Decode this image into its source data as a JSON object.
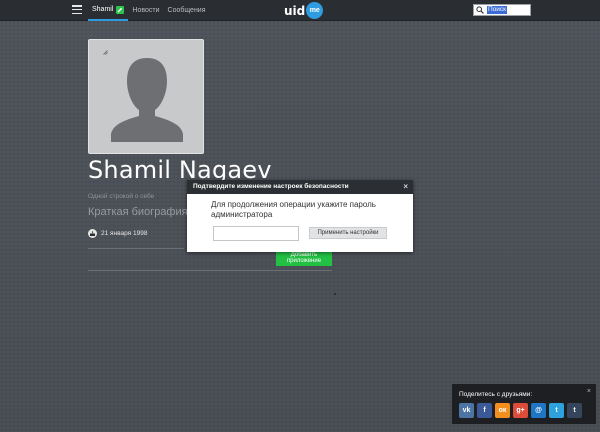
{
  "topbar": {
    "nav": [
      {
        "label": "Shamil",
        "active": true
      },
      {
        "label": "Новости",
        "active": false
      },
      {
        "label": "Сообщения",
        "active": false
      }
    ],
    "logo": {
      "text": "uid",
      "badge": "me"
    },
    "search": {
      "value": "Поиск"
    }
  },
  "profile": {
    "name": "Shamil Nagaev",
    "tagline": "Одной строкой о себе",
    "bio": "Краткая биография",
    "birthday": "21 января 1998",
    "add_app": [
      "Добавить",
      "приложение"
    ]
  },
  "modal": {
    "title": "Подтвердите изменение настроек безопасности",
    "close": "×",
    "message": "Для продолжения операции укажите пароль администратора",
    "password_value": "",
    "apply_label": "Применить настройки"
  },
  "share": {
    "title": "Поделитесь с друзьями:",
    "close": "×",
    "networks": [
      {
        "name": "vk",
        "glyph": "vk",
        "color": "#4c75a3"
      },
      {
        "name": "facebook",
        "glyph": "f",
        "color": "#3b5998"
      },
      {
        "name": "odnoklassniki",
        "glyph": "ок",
        "color": "#f28f1f"
      },
      {
        "name": "google-plus",
        "glyph": "g+",
        "color": "#dd4b39"
      },
      {
        "name": "moimir",
        "glyph": "@",
        "color": "#1e76c4"
      },
      {
        "name": "twitter",
        "glyph": "t",
        "color": "#2ea2dc"
      },
      {
        "name": "tumblr",
        "glyph": "t",
        "color": "#35465c"
      }
    ]
  },
  "colors": {
    "accent": "#2f9be0",
    "green": "#22c043",
    "topbar": "#2a2d31",
    "background": "#4f545b"
  }
}
